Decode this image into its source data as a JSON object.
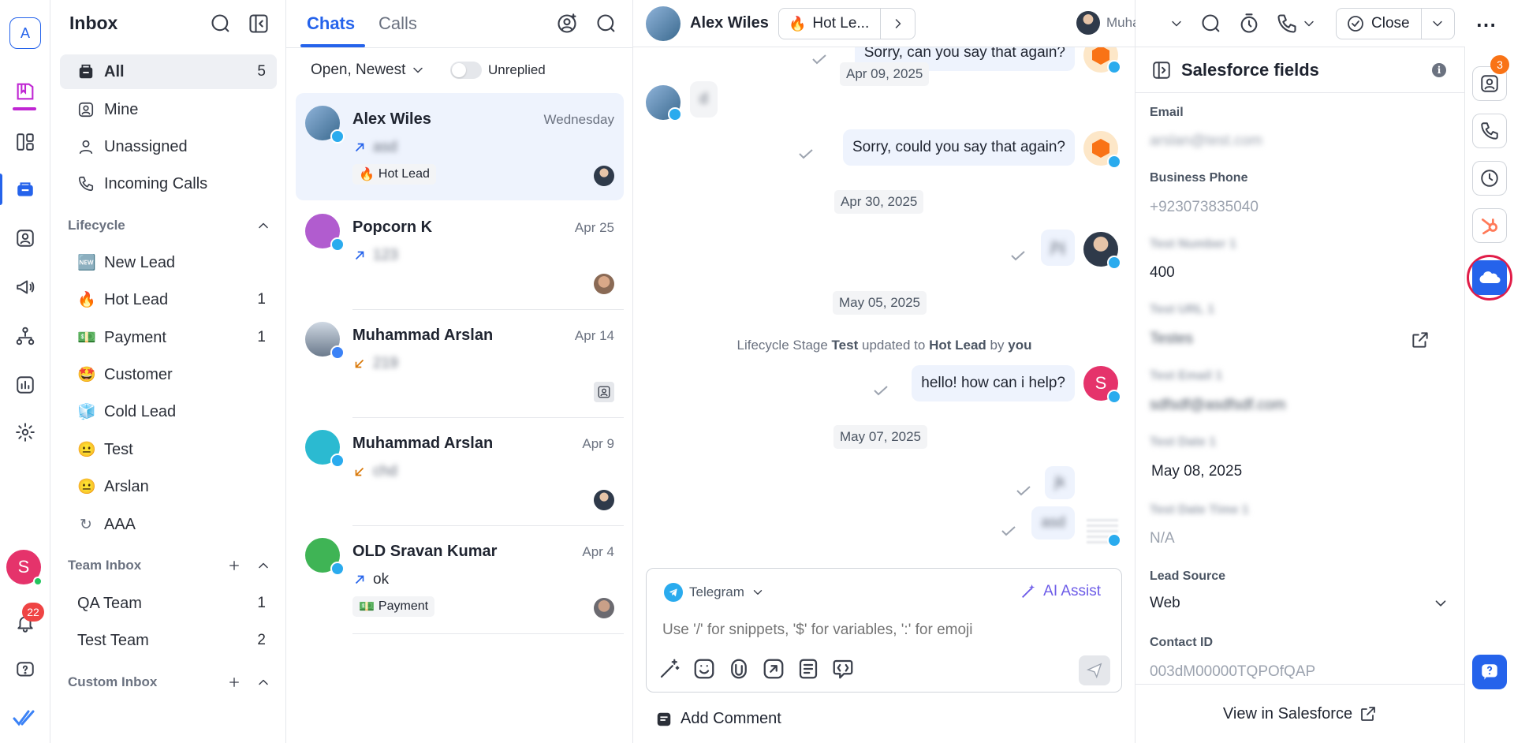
{
  "rail": {
    "workspace_letter": "A",
    "notif_count": "22",
    "user_initial": "S"
  },
  "sidebar": {
    "title": "Inbox",
    "items": [
      {
        "label": "All",
        "count": "5"
      },
      {
        "label": "Mine",
        "count": ""
      },
      {
        "label": "Unassigned",
        "count": ""
      },
      {
        "label": "Incoming Calls",
        "count": ""
      }
    ],
    "lifecycle_title": "Lifecycle",
    "lifecycle": [
      {
        "emoji": "🆕",
        "label": "New Lead",
        "count": ""
      },
      {
        "emoji": "🔥",
        "label": "Hot Lead",
        "count": "1"
      },
      {
        "emoji": "💵",
        "label": "Payment",
        "count": "1"
      },
      {
        "emoji": "🤩",
        "label": "Customer",
        "count": ""
      },
      {
        "emoji": "🧊",
        "label": "Cold Lead",
        "count": ""
      },
      {
        "emoji": "😐",
        "label": "Test",
        "count": ""
      },
      {
        "emoji": "😐",
        "label": "Arslan",
        "count": ""
      },
      {
        "emoji": "↻",
        "label": "AAA",
        "count": ""
      }
    ],
    "team_title": "Team Inbox",
    "teams": [
      {
        "label": "QA Team",
        "count": "1"
      },
      {
        "label": "Test Team",
        "count": "2"
      }
    ],
    "custom_title": "Custom Inbox"
  },
  "chatlist": {
    "tabs": [
      "Chats",
      "Calls"
    ],
    "filter": "Open, Newest",
    "unreplied": "Unreplied",
    "conversations": [
      {
        "name": "Alex Wiles",
        "date": "Wednesday",
        "preview": "asd",
        "tag": "Hot Lead",
        "tag_emoji": "🔥"
      },
      {
        "name": "Popcorn K",
        "date": "Apr 25",
        "preview": "123",
        "tag": "",
        "tag_emoji": ""
      },
      {
        "name": "Muhammad Arslan",
        "date": "Apr 14",
        "preview": "219",
        "tag": "",
        "tag_emoji": ""
      },
      {
        "name": "Muhammad Arslan",
        "date": "Apr 9",
        "preview": "chd",
        "tag": "",
        "tag_emoji": ""
      },
      {
        "name": "OLD Sravan Kumar",
        "date": "Apr 4",
        "preview": "ok",
        "tag": "Payment",
        "tag_emoji": "💵"
      }
    ]
  },
  "chat": {
    "contact_name": "Alex Wiles",
    "lifecycle_chip": "Hot Le...",
    "lifecycle_emoji": "🔥",
    "assignee": "Muha...",
    "close_label": "Close",
    "messages": {
      "m1": "Sorry, can you say that again?",
      "d1": "Apr 09, 2025",
      "m2": "d",
      "m3": "Sorry, could you say that again?",
      "d2": "Apr 30, 2025",
      "m4": "jhj",
      "d3": "May 05, 2025",
      "event_pre": "Lifecycle Stage",
      "event_stage": "Test",
      "event_mid": "updated to",
      "event_new": "Hot Lead",
      "event_by": "by",
      "event_you": "you",
      "m5": "hello! how can i help?",
      "m5_avatar": "S",
      "d4": "May 07, 2025",
      "m6": "jk",
      "m7": "asd"
    },
    "composer": {
      "channel": "Telegram",
      "ai_assist": "AI Assist",
      "placeholder": "Use '/' for snippets, '$' for variables, ':' for emoji"
    },
    "add_comment": "Add Comment"
  },
  "salesforce": {
    "title": "Salesforce fields",
    "fields": [
      {
        "label": "Email",
        "value": "arslan@test.com"
      },
      {
        "label": "Business Phone",
        "value": "+923073835040"
      },
      {
        "label": "Test Number 1",
        "value": "400"
      },
      {
        "label": "Test URL 1",
        "value": "Testes"
      },
      {
        "label": "Test Email 1",
        "value": "sdfsdf@asdfsdf.com"
      },
      {
        "label": "Test Date 1",
        "value": "May 08, 2025"
      },
      {
        "label": "Test Date Time 1",
        "value": "N/A"
      },
      {
        "label": "Lead Source",
        "value": "Web"
      },
      {
        "label": "Contact ID",
        "value": "003dM00000TQPOfQAP"
      }
    ],
    "view_link": "View in Salesforce"
  },
  "right_rail": {
    "contact_badge": "3"
  }
}
